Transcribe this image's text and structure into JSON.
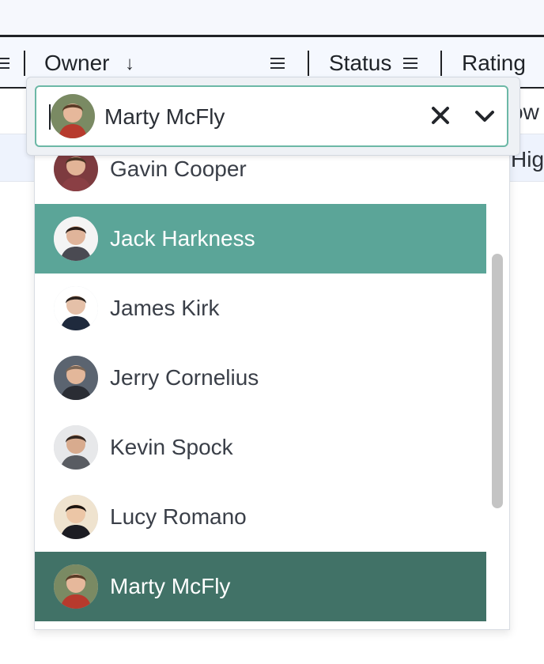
{
  "header": {
    "columns": [
      {
        "label": "Owner",
        "sort_icon": "arrow-down-icon",
        "menu_icon": "menu-icon"
      },
      {
        "label": "Status",
        "menu_icon": "menu-icon"
      },
      {
        "label": "Rating"
      }
    ]
  },
  "grid": {
    "row1_peek": "ow",
    "row2_peek": "High"
  },
  "editor": {
    "selected_value": "Marty McFly",
    "clear_icon": "close-icon",
    "toggle_icon": "chevron-down-icon"
  },
  "options": [
    {
      "name": "Gavin Cooper",
      "state": "normal",
      "avatar": {
        "bg": "#7d3b3f",
        "skin": "#e2b497",
        "hair": "#4a3424",
        "shirt": "#8a3f44"
      }
    },
    {
      "name": "Jack Harkness",
      "state": "active",
      "avatar": {
        "bg": "#f4f4f4",
        "skin": "#e0b49a",
        "hair": "#2a1d17",
        "shirt": "#4a4a52"
      }
    },
    {
      "name": "James Kirk",
      "state": "normal",
      "avatar": {
        "bg": "#ffffff",
        "skin": "#e5c0a8",
        "hair": "#2a211c",
        "shirt": "#1f2a3d"
      }
    },
    {
      "name": "Jerry Cornelius",
      "state": "normal",
      "avatar": {
        "bg": "#5b6470",
        "skin": "#e3b79a",
        "hair": "#7a6656",
        "shirt": "#2a2d34"
      }
    },
    {
      "name": "Kevin Spock",
      "state": "normal",
      "avatar": {
        "bg": "#e7e8ea",
        "skin": "#d8ab8e",
        "hair": "#33261f",
        "shirt": "#595c62"
      }
    },
    {
      "name": "Lucy Romano",
      "state": "normal",
      "avatar": {
        "bg": "#efe3cf",
        "skin": "#ecc6a6",
        "hair": "#1b1410",
        "shirt": "#1c1c22"
      }
    },
    {
      "name": "Marty McFly",
      "state": "selected",
      "avatar": {
        "bg": "#7a8a63",
        "skin": "#e6b89b",
        "hair": "#5a3b26",
        "shirt": "#b73a2d"
      }
    }
  ]
}
